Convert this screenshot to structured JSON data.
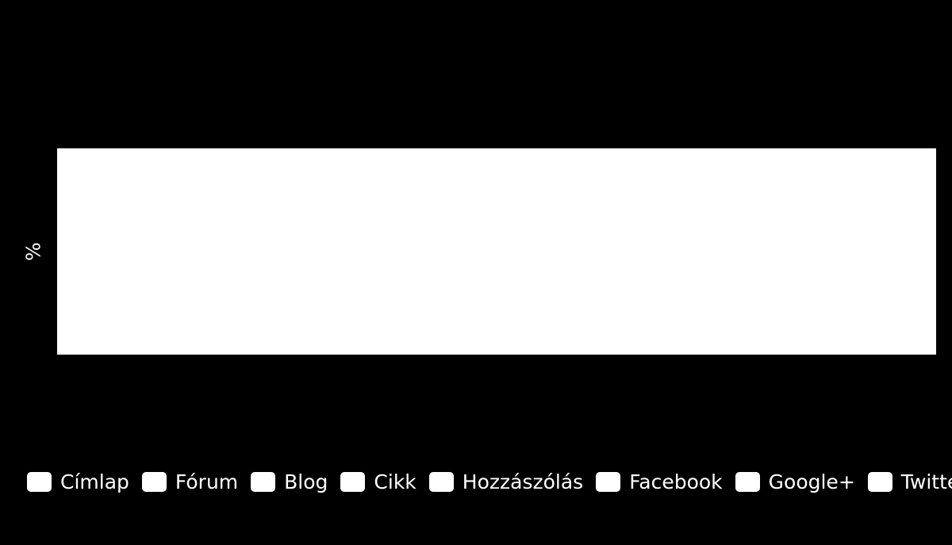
{
  "chart_data": {
    "type": "bar",
    "title": "",
    "subtitle": "",
    "xlabel": "",
    "ylabel": "%",
    "categories": [],
    "x_tick_labels": [],
    "y_tick_labels": [],
    "grid": false,
    "legend_position": "bottom",
    "plot_background": "#ffffff",
    "chart_background": "#000000",
    "series": [
      {
        "name": "Címlap",
        "values": [],
        "color": "#ffffff"
      },
      {
        "name": "Fórum",
        "values": [],
        "color": "#ffffff"
      },
      {
        "name": "Blog",
        "values": [],
        "color": "#ffffff"
      },
      {
        "name": "Cikk",
        "values": [],
        "color": "#ffffff"
      },
      {
        "name": "Hozzászólás",
        "values": [],
        "color": "#ffffff"
      },
      {
        "name": "Facebook",
        "values": [],
        "color": "#ffffff"
      },
      {
        "name": "Google+",
        "values": [],
        "color": "#ffffff"
      },
      {
        "name": "Twitter",
        "values": [],
        "color": "#ffffff"
      }
    ],
    "annotations": []
  },
  "axis": {
    "y_title": "%"
  },
  "legend": {
    "items": [
      {
        "label": "Címlap",
        "color": "#ffffff",
        "swatch": "legend-swatch-cimlap"
      },
      {
        "label": "Fórum",
        "color": "#ffffff",
        "swatch": "legend-swatch-forum"
      },
      {
        "label": "Blog",
        "color": "#ffffff",
        "swatch": "legend-swatch-blog"
      },
      {
        "label": "Cikk",
        "color": "#ffffff",
        "swatch": "legend-swatch-cikk"
      },
      {
        "label": "Hozzászólás",
        "color": "#ffffff",
        "swatch": "legend-swatch-hozzaszolas"
      },
      {
        "label": "Facebook",
        "color": "#ffffff",
        "swatch": "legend-swatch-facebook"
      },
      {
        "label": "Google+",
        "color": "#ffffff",
        "swatch": "legend-swatch-googleplus"
      },
      {
        "label": "Twitter",
        "color": "#ffffff",
        "swatch": "legend-swatch-twitter"
      }
    ]
  },
  "colors": {
    "background": "#000000",
    "plot_background": "#ffffff",
    "text": "#ffffff"
  }
}
